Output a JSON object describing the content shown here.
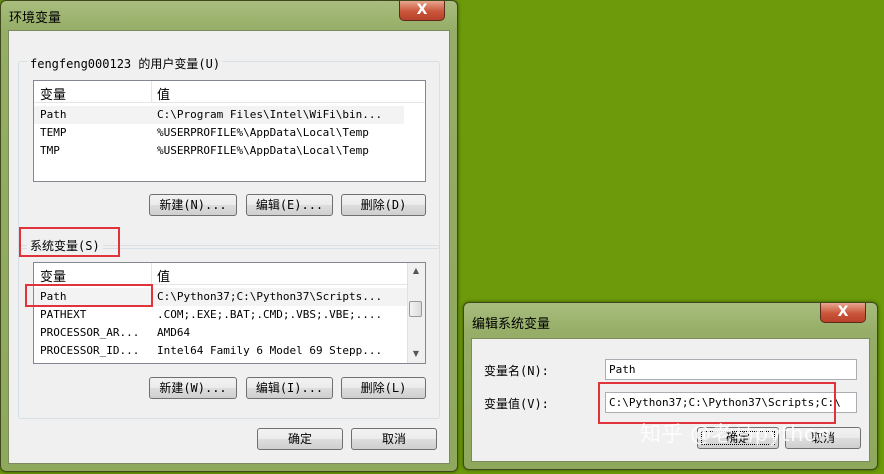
{
  "env_dialog": {
    "title": "环境变量",
    "close_label": "X",
    "user_group_label": "fengfeng000123 的用户变量(U)",
    "columns": {
      "name": "变量",
      "value": "值"
    },
    "user_rows": [
      {
        "name": "Path",
        "value": "C:\\Program Files\\Intel\\WiFi\\bin..."
      },
      {
        "name": "TEMP",
        "value": "%USERPROFILE%\\AppData\\Local\\Temp"
      },
      {
        "name": "TMP",
        "value": "%USERPROFILE%\\AppData\\Local\\Temp"
      }
    ],
    "user_buttons": {
      "new": "新建(N)...",
      "edit": "编辑(E)...",
      "delete": "删除(D)"
    },
    "system_group_label": "系统变量(S)",
    "system_rows": [
      {
        "name": "Path",
        "value": "C:\\Python37;C:\\Python37\\Scripts..."
      },
      {
        "name": "PATHEXT",
        "value": ".COM;.EXE;.BAT;.CMD;.VBS;.VBE;...."
      },
      {
        "name": "PROCESSOR_AR...",
        "value": "AMD64"
      },
      {
        "name": "PROCESSOR_ID...",
        "value": "Intel64 Family 6 Model 69 Stepp..."
      }
    ],
    "system_buttons": {
      "new": "新建(W)...",
      "edit": "编辑(I)...",
      "delete": "删除(L)"
    },
    "ok": "确定",
    "cancel": "取消"
  },
  "edit_dialog": {
    "title": "编辑系统变量",
    "close_label": "X",
    "name_label": "变量名(N):",
    "name_value": "Path",
    "value_label": "变量值(V):",
    "value_value": "C:\\Python37;C:\\Python37\\Scripts;C:\\",
    "ok": "确定",
    "cancel": "取消"
  },
  "watermark": "知乎 @老马python",
  "colors": {
    "desktop": "#6c9a0a",
    "highlight": "#e0343a"
  }
}
